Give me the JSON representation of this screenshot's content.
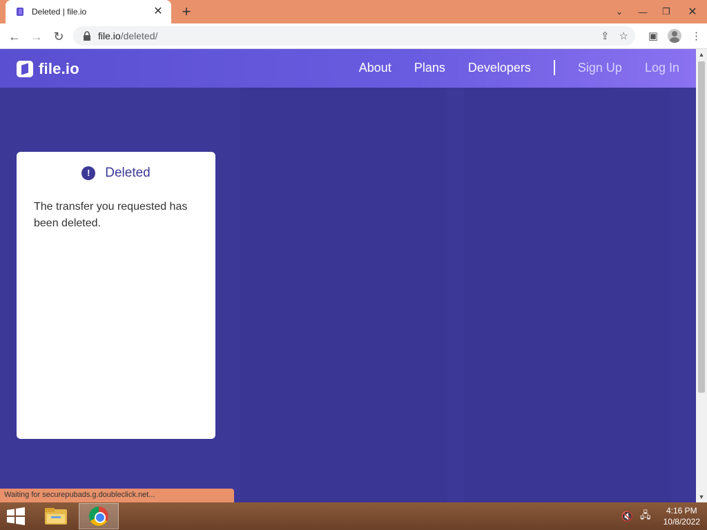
{
  "browser": {
    "tab_title": "Deleted | file.io",
    "new_tab_label": "+",
    "url_host": "file.io",
    "url_path": "/deleted/",
    "status_text": "Waiting for securepubads.g.doubleclick.net..."
  },
  "site": {
    "logo_text": "file.io",
    "nav": {
      "about": "About",
      "plans": "Plans",
      "developers": "Developers",
      "signup": "Sign Up",
      "login": "Log In"
    },
    "card": {
      "title": "Deleted",
      "alert_glyph": "!",
      "body": "The transfer you requested has been deleted."
    }
  },
  "taskbar": {
    "time": "4:16 PM",
    "date": "10/8/2022"
  },
  "colors": {
    "page_bg": "#3c3898",
    "header_start": "#5a4fd0",
    "header_end": "#8a72f0",
    "tab_strip": "#e8916b"
  }
}
